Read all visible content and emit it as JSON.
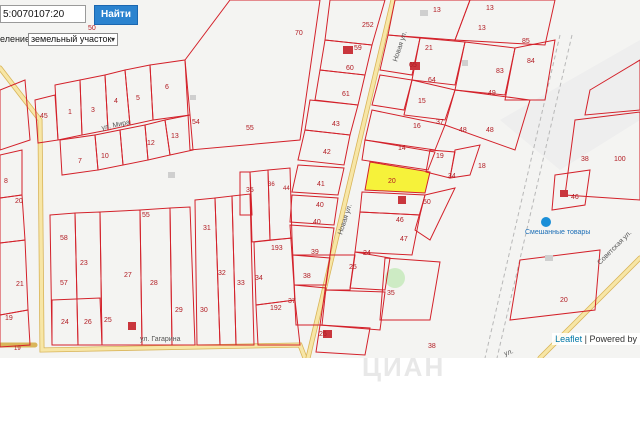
{
  "search": {
    "value": "5:0070107:20",
    "button_label": "Найти"
  },
  "type_filter": {
    "label": "еление",
    "selected": "земельный участок"
  },
  "attribution": {
    "leaflet": "Leaflet",
    "sep": " | ",
    "powered": "Powered by"
  },
  "watermark": "ЦИАН",
  "streets": {
    "mira": "ул. Мира",
    "gagarina": "ул. Гагарина",
    "novaya_top": "Новая ул.",
    "novaya_mid": "Новая ул.",
    "sovetskaya": "Советская ул.",
    "partial": "ул."
  },
  "poi": {
    "shop": "Смешанные товары"
  },
  "parcels": {
    "p252": "252",
    "p13a": "13",
    "p13b": "13",
    "p13c": "13",
    "p70": "70",
    "p59": "59",
    "p60": "60",
    "p61": "61",
    "p85": "85",
    "p83": "83",
    "p84": "84",
    "p65": "65",
    "p64": "64",
    "p21": "21",
    "p49": "49",
    "p15": "15",
    "p16": "16",
    "p48a": "48",
    "p48b": "48",
    "p43": "43",
    "p42": "42",
    "p41": "41",
    "p40a": "40",
    "p40b": "40",
    "p39": "39",
    "p38": "38",
    "p14": "14",
    "p19": "19",
    "p18": "18",
    "p20": "20",
    "p34": "34",
    "p50": "50",
    "p46": "46",
    "p47": "47",
    "p24": "24",
    "p25": "25",
    "p26": "26",
    "p35": "35",
    "p100": "100",
    "p38b": "38",
    "p20b": "20",
    "p46b": "46",
    "p45": "45",
    "p1": "1",
    "p3": "3",
    "p4": "4",
    "p5": "5",
    "p6": "6",
    "p7": "7",
    "p10": "10",
    "p12": "12",
    "p13d": "13",
    "p55a": "55",
    "p55b": "55",
    "p8": "8",
    "p20c": "20",
    "p19b": "19",
    "p21b": "21",
    "p23": "23",
    "p27": "27",
    "p28": "28",
    "p57": "57",
    "p29": "29",
    "p30": "30",
    "p31": "31",
    "p32": "32",
    "p33": "33",
    "p34b": "34",
    "p35b": "35",
    "p193": "193",
    "p192": "192",
    "p37": "37",
    "p25b": "25",
    "p26b": "26",
    "p24b": "24",
    "p19c": "19",
    "p50b": "50",
    "p38c": "38",
    "p37b": "37",
    "p54": "54",
    "p58": "58",
    "p44": "44",
    "p36": "36"
  }
}
